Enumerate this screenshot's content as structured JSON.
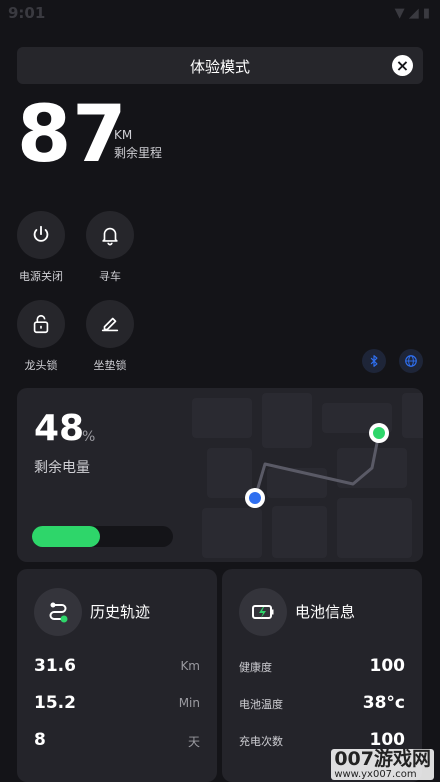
{
  "status_bar": {
    "time": "9:01"
  },
  "banner": {
    "title": "体验模式"
  },
  "range": {
    "value": "87",
    "unit": "KM",
    "label": "剩余里程"
  },
  "controls": [
    {
      "label": "电源关闭",
      "icon": "power-icon"
    },
    {
      "label": "寻车",
      "icon": "bell-icon"
    },
    {
      "label": "龙头锁",
      "icon": "lock-icon"
    },
    {
      "label": "坐垫锁",
      "icon": "seat-lock-icon"
    }
  ],
  "quick_icons": [
    "bluetooth-icon",
    "globe-icon"
  ],
  "battery": {
    "percent": "48",
    "unit": "%",
    "label": "剩余电量",
    "level": 0.48,
    "accent": "#2ed66a"
  },
  "history": {
    "title": "历史轨迹",
    "rows": [
      {
        "value": "31.6",
        "unit": "Km"
      },
      {
        "value": "15.2",
        "unit": "Min"
      },
      {
        "value": "8",
        "unit": "天"
      }
    ]
  },
  "battery_info": {
    "title": "电池信息",
    "rows": [
      {
        "label": "健康度",
        "value": "100"
      },
      {
        "label": "电池温度",
        "value": "38°c"
      },
      {
        "label": "充电次数",
        "value": "100"
      }
    ]
  },
  "watermark": {
    "text": "007游戏网",
    "url": "www.yx007.com"
  }
}
